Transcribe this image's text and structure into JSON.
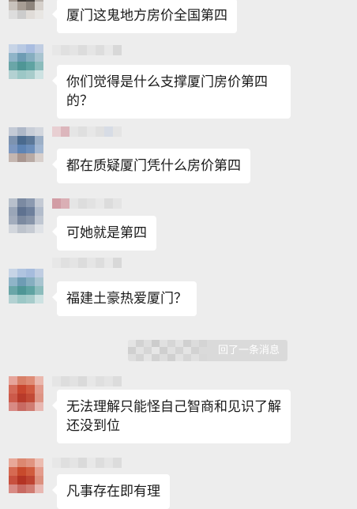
{
  "messages": [
    {
      "text": "厦门这鬼地方房价全国第四"
    },
    {
      "text": "你们觉得是什么支撑厦门房价第四的？"
    },
    {
      "text": "都在质疑厦门凭什么房价第四"
    },
    {
      "text": "可她就是第四"
    },
    {
      "text": "福建土豪热爱厦门？"
    },
    {
      "text": "无法理解只能怪自己智商和见识了解还没到位"
    },
    {
      "text": "凡事存在即有理"
    }
  ],
  "system_notice": {
    "text": "回了一条消息"
  }
}
